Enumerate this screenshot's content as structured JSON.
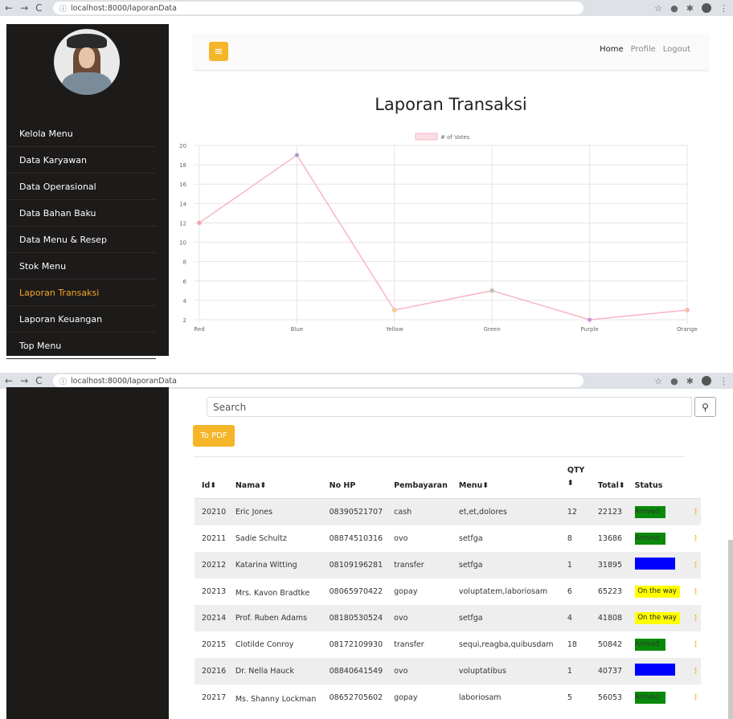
{
  "browser_top": {
    "url": "localhost:8000/laporanData"
  },
  "browser_bottom": {
    "url": "localhost:8000/laporanData"
  },
  "sidebar": {
    "items": [
      {
        "label": "Kelola Menu",
        "active": false
      },
      {
        "label": "Data Karyawan",
        "active": false
      },
      {
        "label": "Data Operasional",
        "active": false
      },
      {
        "label": "Data Bahan Baku",
        "active": false
      },
      {
        "label": "Data Menu & Resep",
        "active": false
      },
      {
        "label": "Stok Menu",
        "active": false
      },
      {
        "label": "Laporan Transaksi",
        "active": true
      },
      {
        "label": "Laporan Keuangan",
        "active": false
      },
      {
        "label": "Top Menu",
        "active": false
      }
    ]
  },
  "header": {
    "home": "Home",
    "profile": "Profile",
    "logout": "Logout",
    "menu_icon": "hamburger-icon"
  },
  "page": {
    "title": "Laporan Transaksi"
  },
  "chart_data": {
    "type": "line",
    "categories": [
      "Red",
      "Blue",
      "Yellow",
      "Green",
      "Purple",
      "Orange"
    ],
    "series": [
      {
        "name": "# of Votes",
        "values": [
          12,
          19,
          3,
          5,
          2,
          3
        ],
        "color": "#f7b6c4"
      }
    ],
    "point_colors": [
      "#f7a0a8",
      "#7fa8d8",
      "#f7d27a",
      "#8fd3b5",
      "#b58fe0",
      "#f7c28a"
    ],
    "ylim": [
      2,
      20
    ],
    "yticks": [
      2,
      4,
      6,
      8,
      10,
      12,
      14,
      16,
      18,
      20
    ],
    "grid": true,
    "legend": "top"
  },
  "search": {
    "placeholder": "Search"
  },
  "export": {
    "label": "To PDF"
  },
  "table": {
    "headers": [
      "Id⬍",
      "Nama⬍",
      "No HP",
      "Pembayaran",
      "Menu⬍",
      "QTY ⬍",
      "Total⬍",
      "Status"
    ],
    "rows": [
      {
        "id": "20210",
        "nama": "Eric Jones",
        "hp": "08390521707",
        "bayar": "cash",
        "menu": "et,et,dolores",
        "qty": "12",
        "total": "22123",
        "status": "Arrived",
        "color": "green"
      },
      {
        "id": "20211",
        "nama": "Sadie Schultz",
        "hp": "08874510316",
        "bayar": "ovo",
        "menu": "setfga",
        "qty": "8",
        "total": "13686",
        "status": "Arrived",
        "color": "green"
      },
      {
        "id": "20212",
        "nama": "Katarina Witting",
        "hp": "08109196281",
        "bayar": "transfer",
        "menu": "setfga",
        "qty": "1",
        "total": "31895",
        "status": "",
        "color": "blue"
      },
      {
        "id": "20213",
        "nama": "Mrs. Kavon Bradtke",
        "hp": "08065970422",
        "bayar": "gopay",
        "menu": "voluptatem,laboriosam",
        "qty": "6",
        "total": "65223",
        "status": "On the way",
        "color": "yellow"
      },
      {
        "id": "20214",
        "nama": "Prof. Ruben Adams",
        "hp": "08180530524",
        "bayar": "ovo",
        "menu": "setfga",
        "qty": "4",
        "total": "41808",
        "status": "On the way",
        "color": "yellow"
      },
      {
        "id": "20215",
        "nama": "Clotilde Conroy",
        "hp": "08172109930",
        "bayar": "transfer",
        "menu": "sequi,reagba,quibusdam",
        "qty": "18",
        "total": "50842",
        "status": "Arrived",
        "color": "green"
      },
      {
        "id": "20216",
        "nama": "Dr. Nella Hauck",
        "hp": "08840641549",
        "bayar": "ovo",
        "menu": "voluptatibus",
        "qty": "1",
        "total": "40737",
        "status": "",
        "color": "blue"
      },
      {
        "id": "20217",
        "nama": "Ms. Shanny Lockman",
        "hp": "08652705602",
        "bayar": "gopay",
        "menu": "laboriosam",
        "qty": "5",
        "total": "56053",
        "status": "Arrived",
        "color": "green"
      }
    ]
  }
}
